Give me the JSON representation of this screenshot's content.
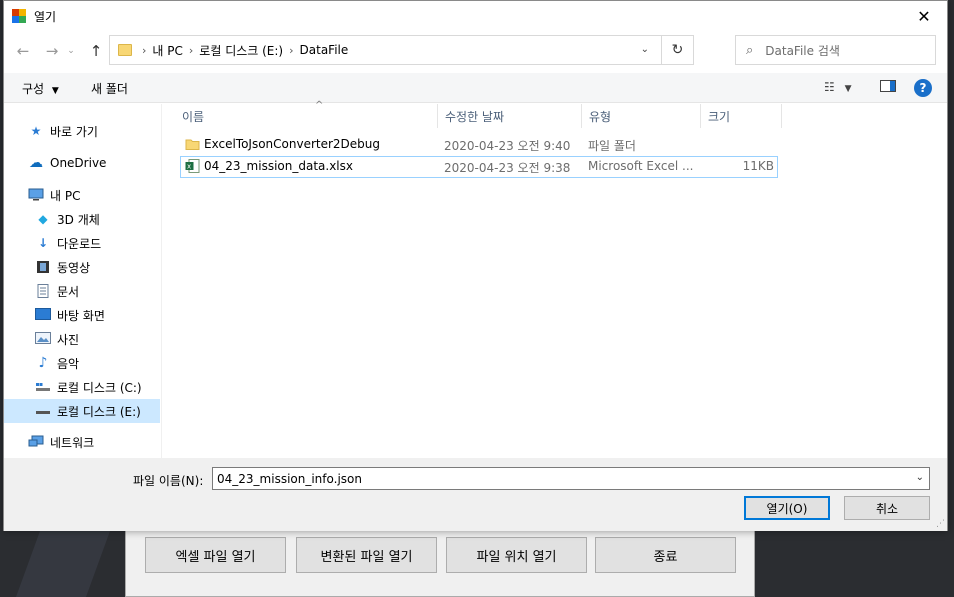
{
  "dialog": {
    "title": "열기",
    "close_glyph": "✕"
  },
  "address": {
    "crumbs": [
      "내 PC",
      "로컬 디스크 (E:)",
      "DataFile"
    ],
    "sep": "›",
    "search_placeholder": "DataFile 검색"
  },
  "toolbar": {
    "organize": "구성",
    "new_folder": "새 폴더"
  },
  "nav": {
    "quick_access": "바로 가기",
    "onedrive": "OneDrive",
    "this_pc": "내 PC",
    "objects3d": "3D 개체",
    "downloads": "다운로드",
    "videos": "동영상",
    "documents": "문서",
    "desktop": "바탕 화면",
    "pictures": "사진",
    "music": "음악",
    "drive_c": "로컬 디스크 (C:)",
    "drive_e": "로컬 디스크 (E:)",
    "network": "네트워크"
  },
  "columns": {
    "name": "이름",
    "date": "수정한 날짜",
    "type": "유형",
    "size": "크기"
  },
  "files": [
    {
      "name": "ExcelToJsonConverter2Debug",
      "date": "2020-04-23 오전 9:40",
      "type": "파일 폴더",
      "size": ""
    },
    {
      "name": "04_23_mission_data.xlsx",
      "date": "2020-04-23 오전 9:38",
      "type": "Microsoft Excel ...",
      "size": "11KB"
    }
  ],
  "bottom": {
    "filename_label": "파일 이름(N):",
    "filename_value": "04_23_mission_info.json",
    "open_label": "열기(O)",
    "cancel_label": "취소"
  },
  "background_app": {
    "buttons": [
      "엑셀 파일 열기",
      "변환된 파일 열기",
      "파일 위치 열기",
      "종료"
    ]
  },
  "colors": {
    "accent": "#0078d7",
    "selection": "#cce8ff",
    "help": "#1a6fc9"
  }
}
